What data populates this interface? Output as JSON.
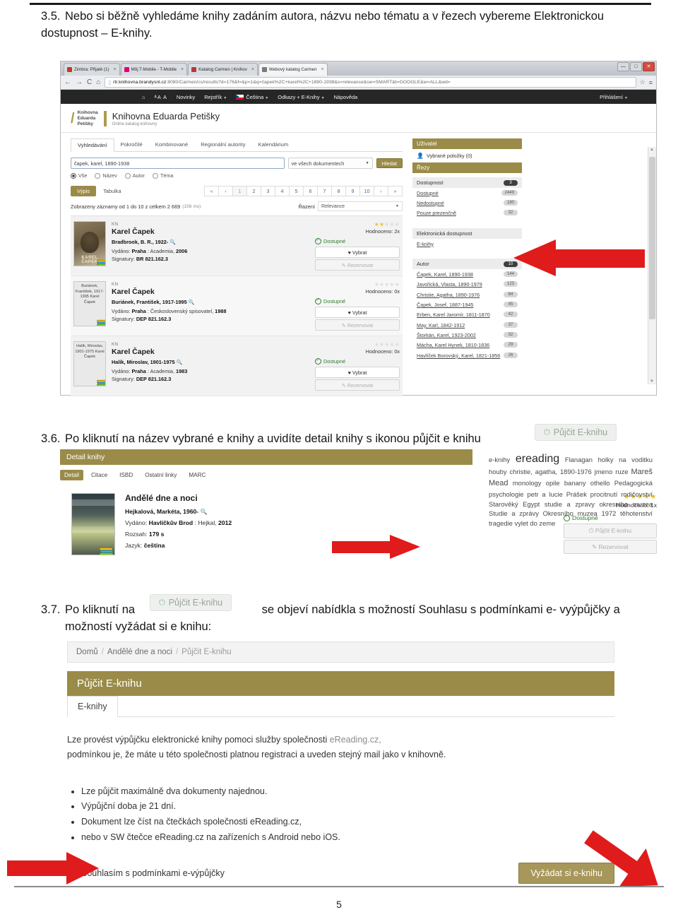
{
  "page": {
    "number": "5"
  },
  "steps": {
    "s35": {
      "num": "3.5.",
      "text": "Nebo si běžně vyhledáme knihy zadáním autora, názvu nebo tématu a v řezech vybereme Elektronickou dostupnost – E-knihy."
    },
    "s36": {
      "num": "3.6.",
      "text": "Po kliknutí na název vybrané e knihy a uvidíte detail knihy s ikonou půjčit e knihu"
    },
    "s37": {
      "num": "3.7.",
      "text_before": "Po kliknutí na",
      "text_after": "se objeví nabídkla s možností Souhlasu s podmínkami e- vyýpůjčky a",
      "text_line2": "možností vyžádat si e knihu:"
    }
  },
  "inline_chip": {
    "label": "Půjčit E-knihu",
    "icon": "power-icon"
  },
  "browser": {
    "tabs": [
      {
        "label": "Zimbra: Přijaté (1)",
        "color": "#c23b22",
        "active": false
      },
      {
        "label": "Můj T-Mobile - T-Mobile",
        "color": "#e20074",
        "active": false
      },
      {
        "label": "Katalog Carmen | Knihov",
        "color": "#b23b3b",
        "active": false
      },
      {
        "label": "Webový katalog Carmen",
        "color": "#7a7a7a",
        "active": true
      }
    ],
    "window_buttons": [
      "—",
      "□",
      "✕"
    ],
    "nav": {
      "back": "←",
      "forward": "→",
      "reload": "C",
      "home": "⌂"
    },
    "url": {
      "host": "rtr.knihovna.brandysnl.cz",
      "rest": ":8080/Carmen/cs/results?d=176&f=&p=1&q=čapek%2C+karel%2C+1890-1938&s=relevance&sw=SMART&t=GOOGLE&w=ALL&wd="
    },
    "url_right": [
      "☆",
      "≡"
    ]
  },
  "site_nav": {
    "home_icon": "home-icon",
    "text_sizes": "ᴬA A",
    "items": [
      {
        "label": "Novinky",
        "caret": false
      },
      {
        "label": "Rejstřík",
        "caret": true
      },
      {
        "label": "Čeština",
        "caret": true,
        "flag": "cz-flag"
      },
      {
        "label": "Odkazy + E-Knihy",
        "caret": true
      },
      {
        "label": "Nápověda",
        "caret": false
      }
    ],
    "login": {
      "label": "Přihlášení",
      "caret": true
    }
  },
  "brand": {
    "logo_lines": [
      "Knihovna",
      "Eduarda",
      "Petišky"
    ],
    "title": "Knihovna Eduarda Petišky",
    "subtitle": "Online katalog knihovny"
  },
  "search": {
    "tabs": [
      "Vyhledávání",
      "Pokročilé",
      "Kombinované",
      "Regionální autority",
      "Kalendárium"
    ],
    "active_tab": "Vyhledávání",
    "query_value": "čapek, karel, 1890-1938",
    "scope_selected": "ve všech dokumentech",
    "submit_label": "Hledat",
    "radios": [
      {
        "label": "Vše",
        "selected": true
      },
      {
        "label": "Název",
        "selected": false
      },
      {
        "label": "Autor",
        "selected": false
      },
      {
        "label": "Téma",
        "selected": false
      }
    ]
  },
  "results_toolbar": {
    "view_active": "Výpis",
    "view_other": "Tabulka",
    "pager": [
      "«",
      "‹",
      "1",
      "2",
      "3",
      "4",
      "5",
      "6",
      "7",
      "8",
      "9",
      "10",
      "›",
      "»"
    ],
    "pager_current": "1",
    "count_text": "Zobrazeny záznamy od 1 do 10 z celkem 2 669",
    "count_ms": "(156 ms)",
    "sort_label": "Řazení",
    "sort_selected": "Relevance"
  },
  "records": [
    {
      "kind": "KN",
      "title": "Karel Čapek",
      "author": "Bradbrook, B. R., 1922-",
      "published_label": "Vydáno:",
      "published_place": "Praha",
      "published_rest": ": Academia,",
      "published_year": "2006",
      "signature_label": "Signatury:",
      "signature": "BR 821.162.3",
      "stars_on": 2,
      "rating": "Hodnoceno: 2x",
      "availability": "Dostupné",
      "select_label": "Vybrat",
      "reserve_label": "Rezervovat",
      "cover_type": "photo",
      "cover_caption": "KAREL ČAPEK"
    },
    {
      "kind": "KN",
      "title": "Karel Čapek",
      "author": "Buriánek, František, 1917-1995",
      "published_label": "Vydáno:",
      "published_place": "Praha",
      "published_rest": ": Československý spisovatel,",
      "published_year": "1988",
      "signature_label": "Signatury:",
      "signature": "DEP 821.162.3",
      "stars_on": 0,
      "rating": "Hodnoceno: 0x",
      "availability": "Dostupné",
      "select_label": "Vybrat",
      "reserve_label": "Rezervovat",
      "cover_type": "text",
      "cover_text": "Buriánek, František, 1917-1995 Karel Čapek"
    },
    {
      "kind": "KN",
      "title": "Karel Čapek",
      "author": "Halík, Miroslav, 1901-1975",
      "published_label": "Vydáno:",
      "published_place": "Praha",
      "published_rest": ": Academia,",
      "published_year": "1983",
      "signature_label": "Signatury:",
      "signature": "DEP 821.162.3",
      "stars_on": 0,
      "rating": "Hodnoceno: 0x",
      "availability": "Dostupné",
      "select_label": "Vybrat",
      "reserve_label": "Rezervovat",
      "cover_type": "text",
      "cover_text": "Halík, Miroslav, 1901-1975 Karel Čapek"
    }
  ],
  "facets": {
    "user_head": "Uživatel",
    "selected_items": "Vybrané položky (0)",
    "cuts_head": "Řezy",
    "groups": [
      {
        "label": "Dostupnost",
        "badge": "3",
        "rows": [
          {
            "label": "Dostupné",
            "count": "2449"
          },
          {
            "label": "Nedostupné",
            "count": "180"
          },
          {
            "label": "Pouze prezenčně",
            "count": "32"
          }
        ]
      },
      {
        "label": "Elektronická dostupnost",
        "badge": "",
        "rows": [
          {
            "label": "E-knihy",
            "count": ""
          }
        ]
      },
      {
        "label": "Autor",
        "badge": "10",
        "rows": [
          {
            "label": "Čapek, Karel, 1890-1938",
            "count": "144"
          },
          {
            "label": "Javořická, Vlasta, 1890-1979",
            "count": "123"
          },
          {
            "label": "Christie, Agatha, 1890-1976",
            "count": "84"
          },
          {
            "label": "Čapek, Josef, 1887-1945",
            "count": "45"
          },
          {
            "label": "Erben, Karel Jaromír, 1811-1870",
            "count": "42"
          },
          {
            "label": "May, Karl, 1842-1912",
            "count": "37"
          },
          {
            "label": "Štorkán, Karel, 1923-2002",
            "count": "32"
          },
          {
            "label": "Mácha, Karel Hynek, 1810-1836",
            "count": "29"
          },
          {
            "label": "Havlíček Borovský, Karel, 1821-1856",
            "count": "26"
          }
        ]
      }
    ]
  },
  "detail": {
    "head": "Detail knihy",
    "tabs": [
      "Detail",
      "Citace",
      "ISBD",
      "Ostatní linky",
      "MARC"
    ],
    "active_tab": "Detail",
    "title": "Andělé dne a noci",
    "author": "Hejkalová, Markéta, 1960-",
    "published_label": "Vydáno:",
    "published_place": "Havlíčkův Brod",
    "published_rest": ": Hejkal,",
    "published_year": "2012",
    "extent_label": "Rozsah:",
    "extent": "179 s",
    "language_label": "Jazyk:",
    "language": "čeština",
    "stars_on": 5,
    "rating": "Hodnoceno: 1x",
    "availability": "Dostupné",
    "lend_label": "Půjčit E-knihu",
    "reserve_label": "Rezervovat"
  },
  "tagcloud": {
    "words": [
      {
        "t": "e-knihy",
        "size": "sm"
      },
      {
        "t": "ereading",
        "size": "big"
      },
      {
        "t": "Flanagan",
        "size": "sm"
      },
      {
        "t": "holky na voditku",
        "size": "sm"
      },
      {
        "t": "houby",
        "size": "sm"
      },
      {
        "t": "christie, agatha, 1890-1976",
        "size": "sm"
      },
      {
        "t": "jmeno ruze",
        "size": "sm"
      },
      {
        "t": "Mareš",
        "size": "med"
      },
      {
        "t": "Mead",
        "size": "med"
      },
      {
        "t": "monology",
        "size": "sm"
      },
      {
        "t": "opile banany",
        "size": "sm"
      },
      {
        "t": "othello",
        "size": "sm"
      },
      {
        "t": "Pedagogická psychologie",
        "size": "sm"
      },
      {
        "t": "petr a lucie",
        "size": "sm"
      },
      {
        "t": "Prášek",
        "size": "sm"
      },
      {
        "t": "procitnutí",
        "size": "sm"
      },
      {
        "t": "rodičovství",
        "size": "sm"
      },
      {
        "t": "Starověký Egypt",
        "size": "sm"
      },
      {
        "t": "studie a zpravy okresniho muzea",
        "size": "sm"
      },
      {
        "t": "Studie a zprávy Okresního muzea 1972",
        "size": "sm"
      },
      {
        "t": "těhotenství",
        "size": "sm"
      },
      {
        "t": "tragedie",
        "size": "sm"
      },
      {
        "t": "vylet do zeme",
        "size": "sm"
      }
    ]
  },
  "loan": {
    "breadcrumbs": [
      "Domů",
      "Andělé dne a noci",
      "Půjčit E-knihu"
    ],
    "head": "Půjčit E-knihu",
    "tab": "E-knihy",
    "para_line1_a": "Lze provést výpůjčku elektronické knihy pomoci služby společnosti ",
    "para_line1_link": "eReading.cz,",
    "para_line2": "podmínkou je, že máte u této společnosti platnou registraci a uveden stejný mail jako v knihovně.",
    "bullets": [
      "Lze půjčit maximálně dva dokumenty najednou.",
      "Výpůjční doba je 21 dní.",
      "Dokument lze číst na čtečkách společnosti eReading.cz,",
      "nebo v SW čtečce eReading.cz na zařízeních s Android nebo iOS."
    ],
    "consent_label": "Souhlasím s podmínkami e-výpůjčky",
    "request_button": "Vyžádat si e-knihu"
  },
  "colors": {
    "gold": "#9a8b48",
    "gold_button": "#a8975a",
    "arrow_red": "#e01b1b",
    "available_green": "#2d7a2d"
  }
}
